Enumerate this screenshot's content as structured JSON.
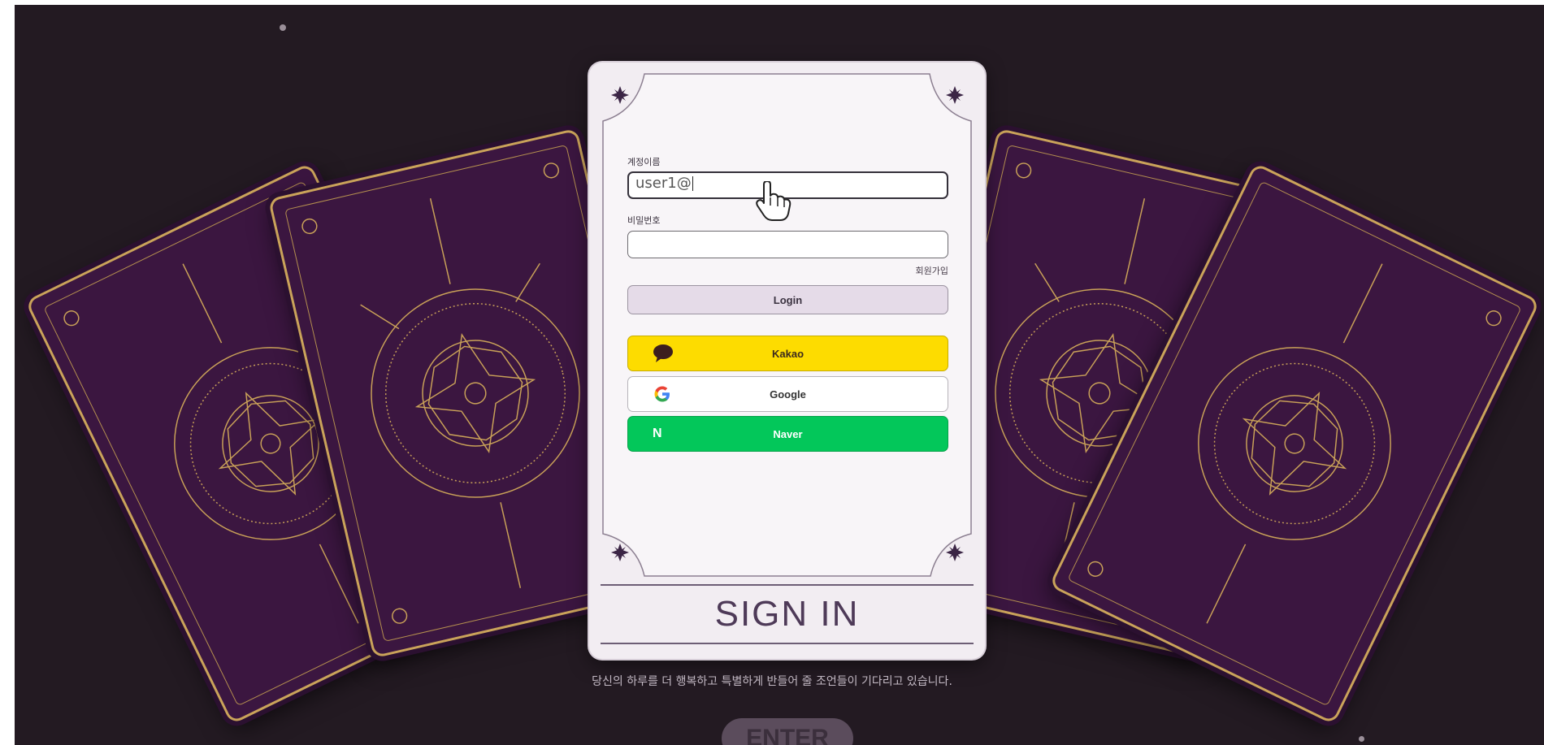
{
  "form": {
    "username_label": "계정이름",
    "username_value": "user1@",
    "password_label": "비밀번호",
    "password_value": "",
    "signup_link": "회원가입",
    "login_label": "Login"
  },
  "social": {
    "kakao_label": "Kakao",
    "google_label": "Google",
    "naver_label": "Naver",
    "naver_logo_letter": "N"
  },
  "title": "SIGN IN",
  "tagline": "당신의 하루를 더 행복하고 특별하게 반들어 줄 조언들이 기다리고 있습니다.",
  "enter_label": "ENTER",
  "colors": {
    "background": "#231a22",
    "card": "#3b1640",
    "gold": "#caa35a",
    "kakao": "#fddc00",
    "naver": "#03c75a",
    "google_blue": "#4285f4"
  }
}
